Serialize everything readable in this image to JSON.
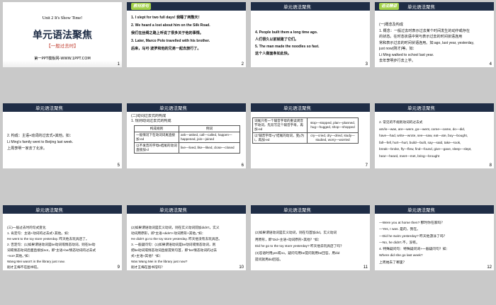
{
  "s1": {
    "unit": "Unit 2   It's Show Time!",
    "title": "单元语法聚焦",
    "subtitle": "【一般过去时】",
    "website": "第一PPT模板网-WWW.1PPT.COM",
    "num": "1"
  },
  "s2": {
    "tag": "教材原句",
    "lines": [
      "1. I slept for two full days! 我睡了两整天！",
      "2. We heard a lost about him on the Silk Road.",
      "我们在丝绸之路上听说了很多关于他的事情。",
      "3. Later, Marco Polo travelled with his brother.",
      "后来，马可·波罗和他的兄弟一起去旅行了。"
    ],
    "num": "2"
  },
  "s3": {
    "title": "单元语法聚焦",
    "lines": [
      "4. People built them a long time ago.",
      "人们很久以前就建了它们。",
      "5. The man made the noodles so fast.",
      "这个人做面条如此快。"
    ],
    "num": "3"
  },
  "s4": {
    "tag": "语法精讲",
    "title": "单元语法聚焦",
    "lines": [
      "(一)概念及构成",
      "1. 概念：一般过去时表示过去某个时间发生的动作或存在",
      "的状态。在时态状语中常与表示过去的时间状语连用",
      "常和表示过去的时间状语连用。如:ago, last year, yesterday,",
      "just now(刚才)等。如：",
      "Li Ming walked to school last year.",
      "去年李明步行去上学。"
    ],
    "num": "4"
  },
  "s5": {
    "title": "单元语法聚焦",
    "lines": [
      "2. 构成：主语+动词的过去式+其他。如：",
      "Li Ming's family went to Beijing last week.",
      "上周李明一家去了北京。"
    ],
    "num": "5"
  },
  "s6": {
    "title": "单元语法聚焦",
    "lines": [
      "(二)动词过去式的构成",
      "1. 规则动词过去式的构成"
    ],
    "table": {
      "head": [
        "构成规则",
        "例词"
      ],
      "rows": [
        [
          "一般情况下在动词词尾直接加-ed",
          "ask—asked, call—called, happen—happened, join—joined"
        ],
        [
          "以不发音的字母e结尾的动词直接加-d",
          "live—lived, like—liked, close—closed"
        ]
      ]
    },
    "num": "6"
  },
  "s7": {
    "title": "单元语法聚焦",
    "table": {
      "rows": [
        [
          "词尾只有一个辅音字母的重读闭音节动词，先双写这个辅音字母，再加-ed",
          "stop—stopped, plan—planned, hug—hugged, shop—shopped"
        ],
        [
          "以“辅音字母+y”结尾的动词，变y为i，再加-ed",
          "cry—cried, dry—dried, study—studied, worry—worried"
        ]
      ]
    },
    "num": "7"
  },
  "s8": {
    "title": "单元语法聚焦",
    "lines": [
      "2. 常见的不规则动词的过去式",
      "am/is—was, are—were, go—went, come—came, do—did,",
      "have—had, write—wrote, see—saw, eat—ate, buy—bought,",
      "fall—fell, hurt—hurt, build—built, say—said, take—took,",
      "break—broke, fly—flew, find—found, give—gave, sleep—slept,",
      "hear—heard, meet—met, bring—brought"
    ],
    "num": "8"
  },
  "s9": {
    "title": "单元语法聚焦",
    "lines": [
      "(三)一般过去时的句式变化",
      "1. 肯定句：主语+动词的过去式+其他。如：",
      "He went to the toy store yesterday.   昨天他去玩具店了。",
      "2. 否定句：(1)如果谓语动词是be动词或情态动词，则在be动",
      "词或情态动词后面直接加not，即“主语+be/情态动词的过去式",
      "+not+其他。”如：",
      "Wang Mei wasn't in the library just now.",
      "刚才王梅不在图书馆。"
    ],
    "num": "9"
  },
  "s10": {
    "title": "单元语法聚焦",
    "lines": [
      "(2)如果谓语动词是实义动词，则在实义动词前加didn't，实义",
      "动词用原形，即“主语+didn't+动词原形+其他。”如：",
      "He didn't go to the toy store yesterday.  昨天他没有去玩具店。",
      "3. 一般疑问句：(1)如果谓语动词是be动词或情态动词，则",
      "把be动词或情态动词直接提到句首，即“be/情态动词的过去",
      "式+主语+其他？”如：",
      "Was Wang Mei in the library just now?",
      "刚才王梅在图书馆吗？"
    ],
    "num": "10"
  },
  "s11": {
    "title": "单元语法聚焦",
    "lines": [
      "(2)如果谓语动词是实义动词，则在句首加did，实义动词",
      "用原形，即“Did+主语+动词原形+其他？”如：",
      "Did he go to the toy store yesterday?  昨天他去玩具店了吗？",
      "(3)答语时用yes或no，疑问句用be提问就用be回答，用did",
      "提问就用did回答。"
    ],
    "num": "11"
  },
  "s12": {
    "title": "单元语法聚焦",
    "lines": [
      "—Were you at home then?  那时你在家吗？",
      "—Yes, I was. 是的，我在。",
      "—Did he swim yesterday?  昨天他游泳了吗？",
      "—No, he didn't.不，没有。",
      "4. 特殊疑问句：特殊疑问词+一般疑问句？如：",
      "Where did she go last week?",
      "上周她去了哪里？"
    ],
    "num": "12"
  }
}
